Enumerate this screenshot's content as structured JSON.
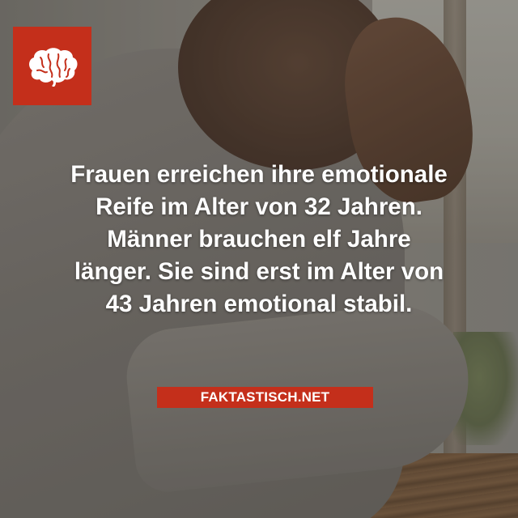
{
  "brand": {
    "logo_icon": "brain-icon",
    "accent_color": "#c42f1b",
    "site_label": "FAKTASTISCH.NET"
  },
  "fact": {
    "lines": [
      "Frauen erreichen ihre emotionale",
      "Reife im Alter von 32 Jahren.",
      "Männer brauchen elf Jahre",
      "länger. Sie sind erst im Alter von",
      "43 Jahren emotional stabil."
    ]
  },
  "photo": {
    "subject": "man-resting-head-on-hand"
  }
}
